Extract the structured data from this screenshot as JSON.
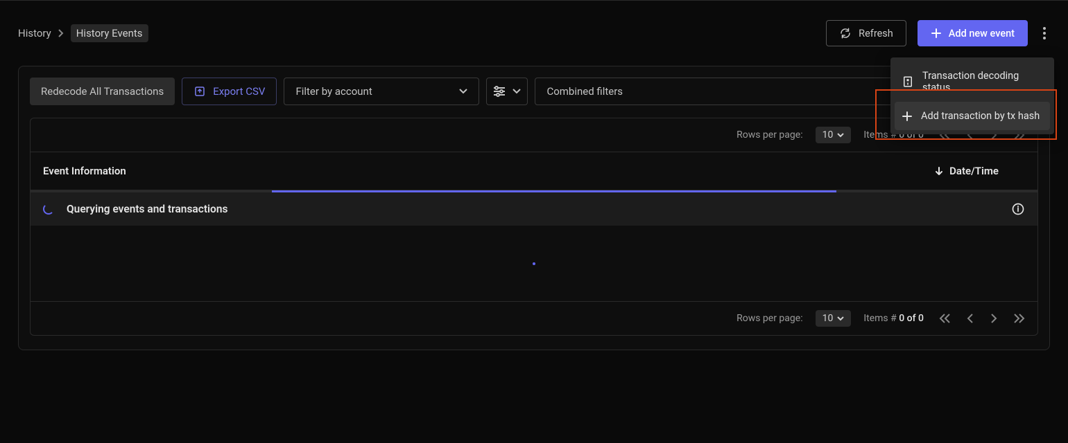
{
  "breadcrumb": {
    "prev": "History",
    "current": "History Events"
  },
  "buttons": {
    "refresh": "Refresh",
    "add_event": "Add new event"
  },
  "menu": {
    "decoding_status": "Transaction decoding status",
    "add_by_hash": "Add transaction by tx hash"
  },
  "filters": {
    "redecode": "Redecode All Transactions",
    "export_csv": "Export CSV",
    "account_placeholder": "Filter by account",
    "combined_placeholder": "Combined filters"
  },
  "table": {
    "col_event": "Event Information",
    "col_date": "Date/Time",
    "loading_text": "Querying events and transactions"
  },
  "pagination": {
    "rows_label": "Rows per page:",
    "rows_value": "10",
    "items_label": "Items #",
    "items_value": "0 of 0"
  }
}
